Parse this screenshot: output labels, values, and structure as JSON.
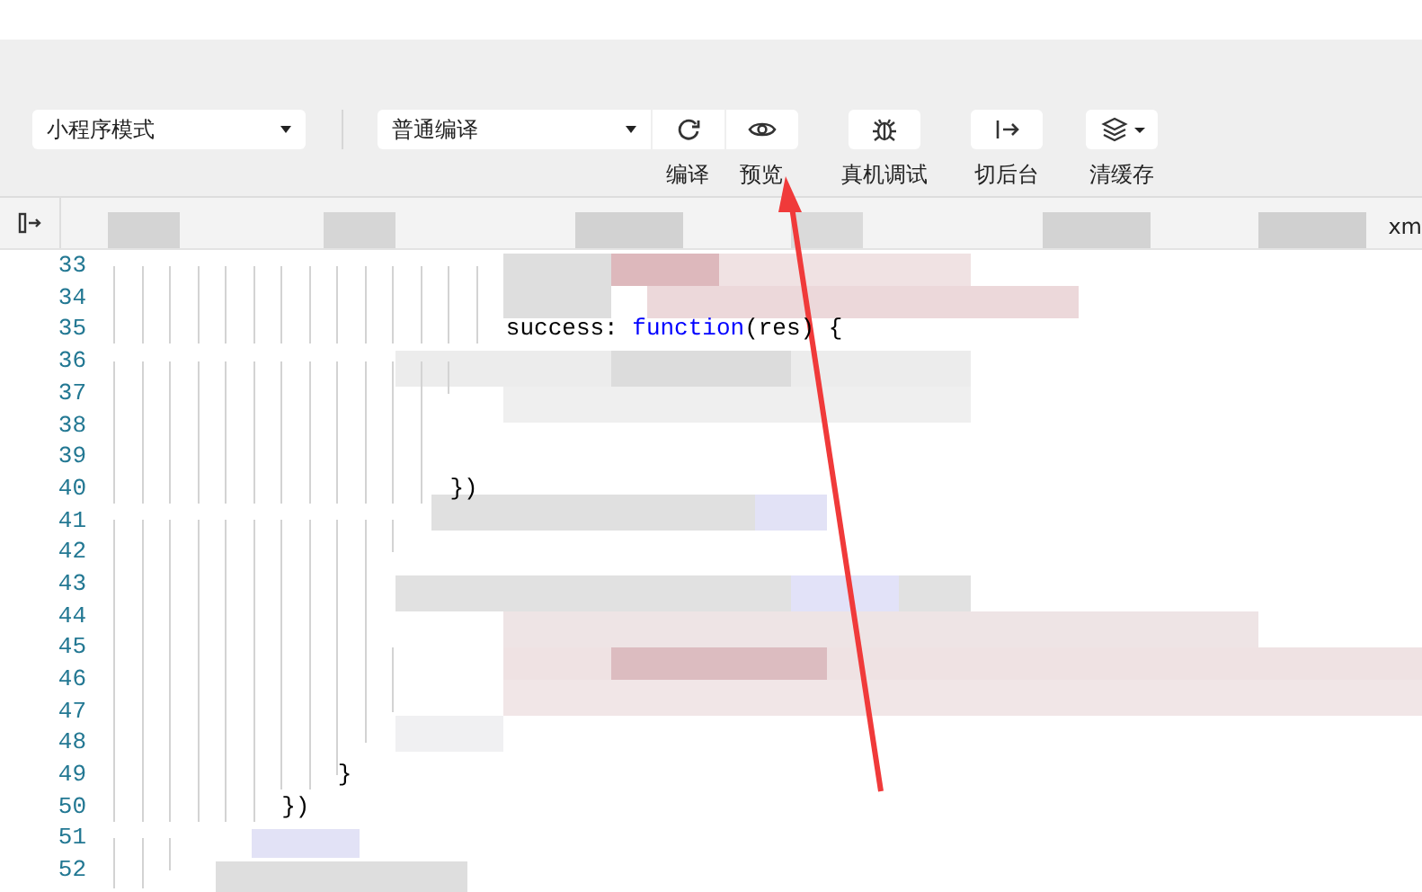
{
  "toolbar": {
    "mode_select": {
      "value": "小程序模式"
    },
    "compile_select": {
      "value": "普通编译"
    },
    "buttons": [
      {
        "label": "编译",
        "kind": "refresh",
        "attached": true
      },
      {
        "label": "预览",
        "kind": "eye",
        "attached": true
      },
      {
        "label": "真机调试",
        "kind": "bug"
      },
      {
        "label": "切后台",
        "kind": "switch"
      },
      {
        "label": "清缓存",
        "kind": "layers",
        "dropdown": true
      }
    ]
  },
  "tab_bar": {
    "tabs": [
      {
        "label": "xm"
      }
    ]
  },
  "editor": {
    "lines": [
      {
        "number": "33"
      },
      {
        "number": "34"
      },
      {
        "number": "35",
        "code": "                            success: function(res) {"
      },
      {
        "number": "36"
      },
      {
        "number": "37"
      },
      {
        "number": "38"
      },
      {
        "number": "39"
      },
      {
        "number": "40",
        "code": "                        })"
      },
      {
        "number": "41"
      },
      {
        "number": "42"
      },
      {
        "number": "43"
      },
      {
        "number": "44"
      },
      {
        "number": "45"
      },
      {
        "number": "46"
      },
      {
        "number": "47"
      },
      {
        "number": "48"
      },
      {
        "number": "49",
        "code": "                }"
      },
      {
        "number": "50",
        "code": "            })"
      },
      {
        "number": "51"
      },
      {
        "number": "52"
      }
    ]
  }
}
